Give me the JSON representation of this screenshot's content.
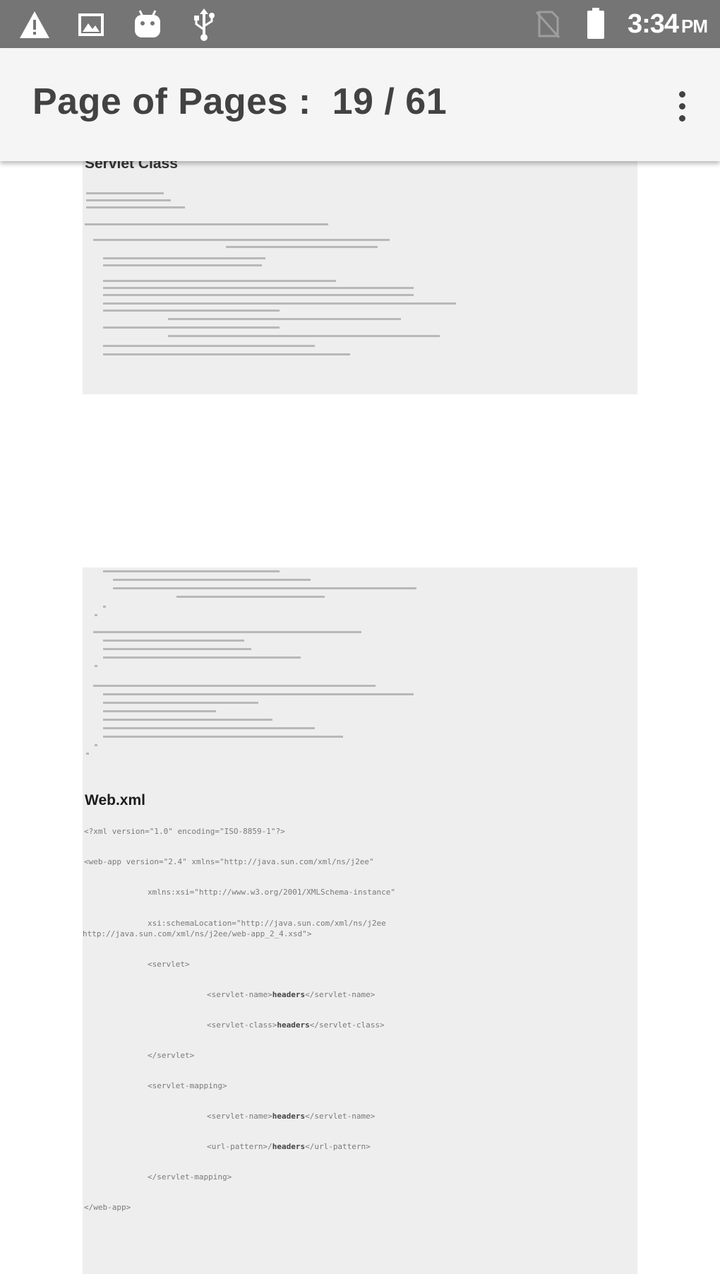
{
  "status_bar": {
    "time": "3:34",
    "ampm": "PM",
    "left_icons": [
      "warning-icon",
      "image-icon",
      "android-icon",
      "usb-icon"
    ],
    "right_icons": [
      "no-sim-icon",
      "battery-icon"
    ]
  },
  "app_bar": {
    "title": "Page of Pages :  19 / 61",
    "menu_icon": "overflow-menu-icon"
  },
  "document": {
    "page1": {
      "heading": "Servlet Class"
    },
    "page2": {
      "heading": "Web.xml",
      "xml_lines": [
        "<?xml version=\"1.0\" encoding=\"ISO-8859-1\"?>",
        "<web-app version=\"2.4\" xmlns=\"http://java.sun.com/xml/ns/j2ee\"",
        "xmlns:xsi=\"http://www.w3.org/2001/XMLSchema-instance\"",
        "xsi:schemaLocation=\"http://java.sun.com/xml/ns/j2ee",
        "http://java.sun.com/xml/ns/j2ee/web-app_2_4.xsd\">",
        "<servlet>",
        "<servlet-name>",
        "</servlet-name>",
        "<servlet-class>",
        "</servlet-class>",
        "</servlet>",
        "<servlet-mapping>",
        "<servlet-name>",
        "</servlet-name>",
        "<url-pattern>/",
        "</url-pattern>",
        "</servlet-mapping>",
        "</web-app>"
      ],
      "servlet_name": "headers"
    }
  }
}
